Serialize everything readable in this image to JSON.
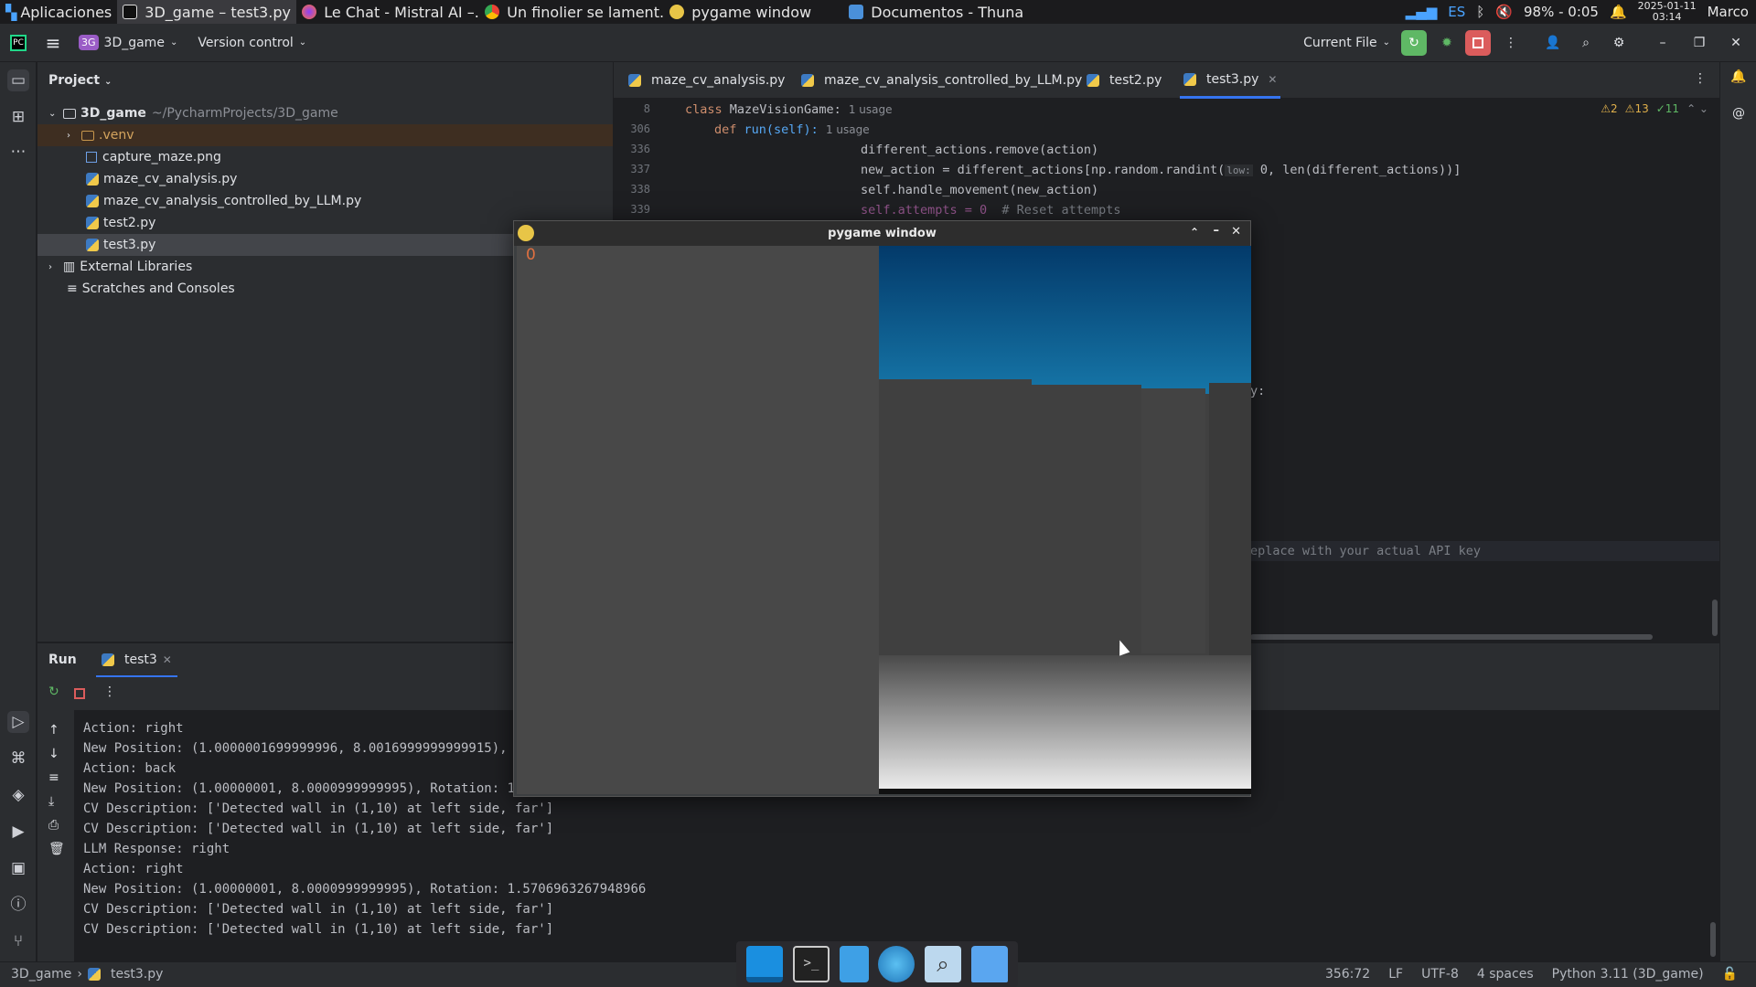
{
  "panel": {
    "apps_label": "Aplicaciones",
    "tasks": [
      {
        "label": "3D_game – test3.py",
        "icon": "pycharm-icon",
        "active": true
      },
      {
        "label": "Le Chat - Mistral AI –...",
        "icon": "firefox-icon",
        "active": false
      },
      {
        "label": "Un finolier se lament...",
        "icon": "chrome-icon",
        "active": false
      },
      {
        "label": "pygame window",
        "icon": "pygame-icon",
        "active": false
      },
      {
        "label": "Documentos - Thunar",
        "icon": "folder-icon",
        "active": false
      }
    ],
    "tray": {
      "lang": "ES",
      "battery": "98% - 0:05",
      "date": "2025-01-11",
      "time": "03:14",
      "user": "Marco"
    }
  },
  "ide": {
    "project_name": "3D_game",
    "project_badge": "3G",
    "vcs": "Version control",
    "run_config": "Current File",
    "colors": {
      "accent": "#3574f0",
      "run_green": "#5fb865",
      "stop_red": "#db5c5c"
    }
  },
  "project_panel": {
    "title": "Project",
    "root": {
      "name": "3D_game",
      "path": "~/PycharmProjects/3D_game"
    },
    "items": [
      ".venv",
      "capture_maze.png",
      "maze_cv_analysis.py",
      "maze_cv_analysis_controlled_by_LLM.py",
      "test2.py",
      "test3.py"
    ],
    "external": "External Libraries",
    "scratches": "Scratches and Consoles"
  },
  "tabs": [
    "maze_cv_analysis.py",
    "maze_cv_analysis_controlled_by_LLM.py",
    "test2.py",
    "test3.py"
  ],
  "editor": {
    "inspections": {
      "warn1": "2",
      "warn2": "13",
      "ok": "11"
    },
    "lines": [
      {
        "n": "8",
        "kw": "class ",
        "name": "MazeVisionGame:",
        "hint": "1 usage"
      },
      {
        "n": "306",
        "kw": "def ",
        "name": "run(self):",
        "hint": "1 usage"
      },
      {
        "n": "336",
        "code": "different_actions.remove(action)"
      },
      {
        "n": "337",
        "code": "new_action = different_actions[np.random.randint(",
        "hint": "low:",
        "code2": " 0, len(different_actions))]"
      },
      {
        "n": "338",
        "code": "self.handle_movement(new_action)"
      },
      {
        "n": "339",
        "code": "self.attempts = 0",
        "comment": "  # Reset attempts"
      }
    ],
    "fragment_colon": "y:",
    "fragment_comment": "eplace with your actual API key"
  },
  "run": {
    "title": "Run",
    "tab": "test3",
    "console": [
      "Action: right",
      "New Position: (1.0000001699999996, 8.0016999999999915), Rotati",
      "Action: back",
      "New Position: (1.00000001, 8.0000999999995), Rotation: 1.57",
      "CV Description: ['Detected wall in (1,10) at left side, far']",
      "CV Description: ['Detected wall in (1,10) at left side, far']",
      "LLM Response: right",
      "Action: right",
      "New Position: (1.00000001, 8.0000999999995), Rotation: 1.5706963267948966",
      "CV Description: ['Detected wall in (1,10) at left side, far']",
      "CV Description: ['Detected wall in (1,10) at left side, far']"
    ]
  },
  "status": {
    "project": "3D_game",
    "file": "test3.py",
    "pos": "356:72",
    "eol": "LF",
    "enc": "UTF-8",
    "indent": "4 spaces",
    "interp": "Python 3.11 (3D_game)"
  },
  "pygame": {
    "title": "pygame window",
    "score": "0"
  }
}
